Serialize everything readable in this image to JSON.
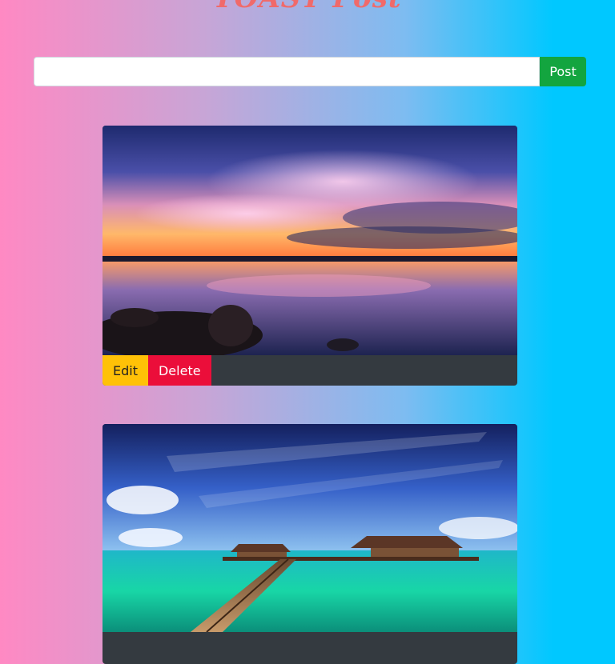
{
  "app": {
    "title": "TOAST Post"
  },
  "composer": {
    "input_value": "",
    "post_label": "Post"
  },
  "posts": [
    {
      "image": "sunset-lake-photo",
      "edit_label": "Edit",
      "delete_label": "Delete"
    },
    {
      "image": "tropical-pier-photo"
    }
  ],
  "colors": {
    "post_button": "#13a53f",
    "edit_button": "#ffc107",
    "delete_button": "#eb0e3a",
    "card_footer": "#343a40",
    "title": "#f06a6a"
  }
}
